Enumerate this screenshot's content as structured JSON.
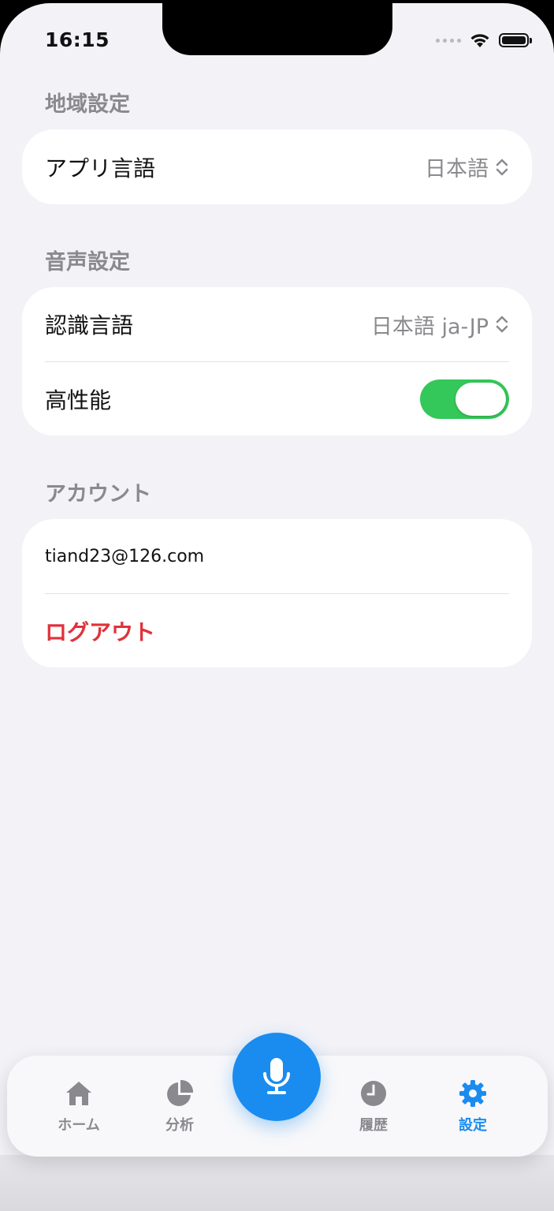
{
  "status_bar": {
    "time": "16:15"
  },
  "sections": {
    "region": {
      "title": "地域設定",
      "app_language": {
        "label": "アプリ言語",
        "value": "日本語"
      }
    },
    "voice": {
      "title": "音声設定",
      "recognition_language": {
        "label": "認識言語",
        "value": "日本語 ja-JP"
      },
      "high_performance": {
        "label": "高性能",
        "enabled": true
      }
    },
    "account": {
      "title": "アカウント",
      "email": "tiand23@126.com",
      "logout_label": "ログアウト"
    }
  },
  "tabbar": {
    "home": "ホーム",
    "analysis": "分析",
    "history": "履歴",
    "settings": "設定",
    "active": "settings"
  },
  "colors": {
    "accent": "#1a8cf0",
    "toggle_on": "#34c759",
    "destructive": "#e0323b",
    "background": "#f2f2f7"
  }
}
